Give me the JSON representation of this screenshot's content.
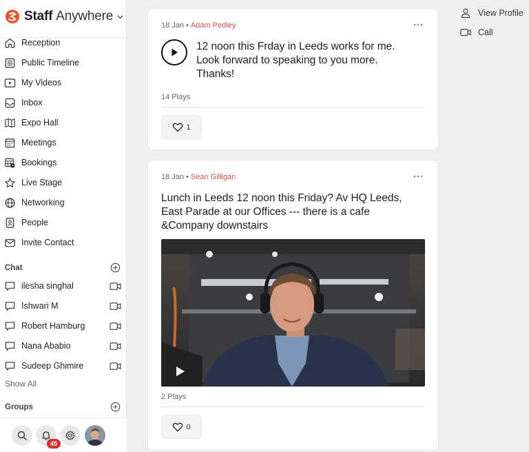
{
  "brand": {
    "name_bold": "Staff",
    "name_light": "Anywhere",
    "accent": "#e8552f"
  },
  "nav": {
    "items": [
      {
        "label": "Reception",
        "icon": "home-icon"
      },
      {
        "label": "Public Timeline",
        "icon": "timeline-icon"
      },
      {
        "label": "My Videos",
        "icon": "video-library-icon"
      },
      {
        "label": "Inbox",
        "icon": "inbox-icon"
      },
      {
        "label": "Expo Hall",
        "icon": "map-icon"
      },
      {
        "label": "Meetings",
        "icon": "calendar-icon"
      },
      {
        "label": "Bookings",
        "icon": "calendar-clock-icon"
      },
      {
        "label": "Live Stage",
        "icon": "star-icon"
      },
      {
        "label": "Networking",
        "icon": "globe-icon"
      },
      {
        "label": "People",
        "icon": "badge-icon"
      },
      {
        "label": "Invite Contact",
        "icon": "mail-icon"
      }
    ]
  },
  "chat": {
    "heading": "Chat",
    "contacts": [
      "ilesha singhal",
      "Ishwari M",
      "Robert Hamburg",
      "Nana Ababio",
      "Sudeep Ghimire"
    ],
    "show_all": "Show All"
  },
  "groups": {
    "heading": "Groups"
  },
  "bottom": {
    "notification_count": "45"
  },
  "posts": [
    {
      "date": "18 Jan",
      "author": "Adam Pedley",
      "text": "12 noon this Frday in Leeds works for me. Look forward to speaking to you more. Thanks!",
      "plays": "14 Plays",
      "likes": "1"
    },
    {
      "date": "18 Jan",
      "author": "Sean Gilligan",
      "text": "Lunch in Leeds 12 noon this Friday? Av HQ Leeds, East Parade at our Offices --- there is a cafe &Company downstairs",
      "plays": "2 Plays",
      "likes": "0"
    }
  ],
  "right_panel": {
    "view_profile": "View Profile",
    "call": "Call"
  },
  "separator": "•"
}
